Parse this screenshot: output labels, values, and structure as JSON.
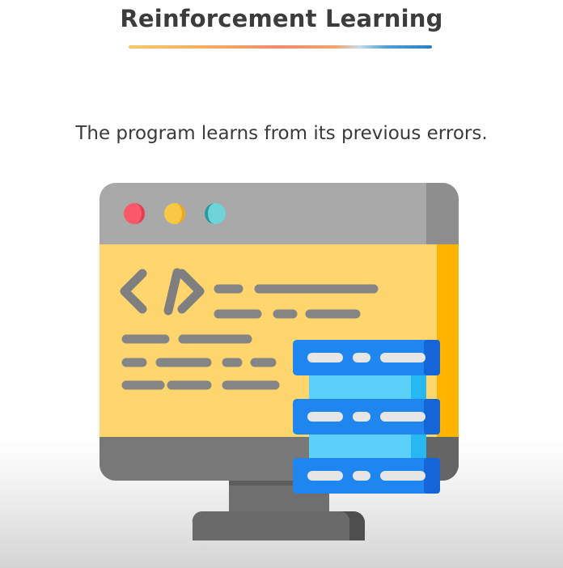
{
  "slide": {
    "title": "Reinforcement Learning",
    "subtitle": "The program learns from its previous errors."
  },
  "illustration": {
    "icon": "monitor-code-database-icon",
    "colors": {
      "screen_frame": "#a8a8a8",
      "screen_body": "#ffd56e",
      "code_lines": "#8a8a8a",
      "dot_red": "#f9596a",
      "dot_yellow": "#f7b731",
      "dot_teal": "#5fc8cf",
      "database_blue": "#1f86f0",
      "database_light": "#5bd0fb"
    }
  }
}
